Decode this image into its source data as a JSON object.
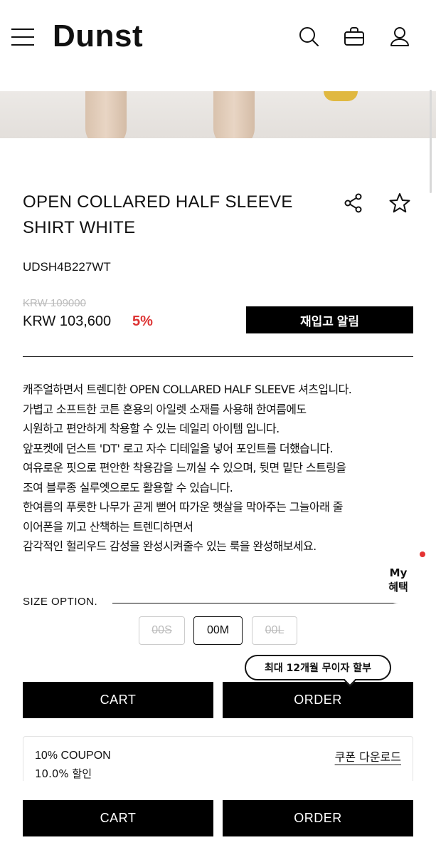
{
  "header": {
    "brand": "Dunst",
    "icons": [
      "menu-icon",
      "search-icon",
      "bag-icon",
      "user-icon"
    ]
  },
  "product": {
    "title_line1": "OPEN COLLARED HALF SLEEVE",
    "title_line2": "SHIRT WHITE",
    "sku": "UDSH4B227WT",
    "original_price": "KRW 109000",
    "price": "KRW 103,600",
    "discount": "5%",
    "restock_label": "재입고 알림"
  },
  "description": [
    "캐주얼하면서 트렌디한 OPEN COLLARED HALF SLEEVE 셔츠입니다.",
    "가볍고 소프트한 코튼 혼용의 아일렛 소재를 사용해 한여름에도",
    "시원하고 편안하게 착용할 수 있는 데일리 아이템 입니다.",
    "앞포켓에 던스트 'DT' 로고 자수 디테일을 넣어 포인트를 더했습니다.",
    "여유로운 핏으로 편안한 착용감을 느끼실 수 있으며, 뒷면 밑단 스트링을",
    "조여 블루종 실루엣으로도 활용할 수 있습니다.",
    "한여름의 푸릇한 나무가 곧게 뻗어 따가운 햇살을 막아주는 그늘아래 줄",
    "이어폰을 끼고 산책하는 트렌디하면서",
    "감각적인 헐리우드 감성을 완성시켜줄수 있는 룩을 완성해보세요."
  ],
  "size": {
    "label": "SIZE OPTION.",
    "options": [
      {
        "label": "00S",
        "available": false
      },
      {
        "label": "00M",
        "available": true,
        "selected": true
      },
      {
        "label": "00L",
        "available": false
      }
    ]
  },
  "benefit": {
    "line1": "My",
    "line2": "혜택"
  },
  "installment_tooltip": "최대 12개월 무이자 할부",
  "actions": {
    "cart": "CART",
    "order": "ORDER"
  },
  "coupon": {
    "title": "10% COUPON",
    "subtitle": "10.0% 할인",
    "download": "쿠폰 다운로드"
  },
  "bottom_bar": {
    "cart": "CART",
    "order": "ORDER"
  },
  "colors": {
    "primary": "#000000",
    "discount": "#dd3333",
    "strike": "#bbbbbb",
    "notification_dot": "#e53333"
  }
}
